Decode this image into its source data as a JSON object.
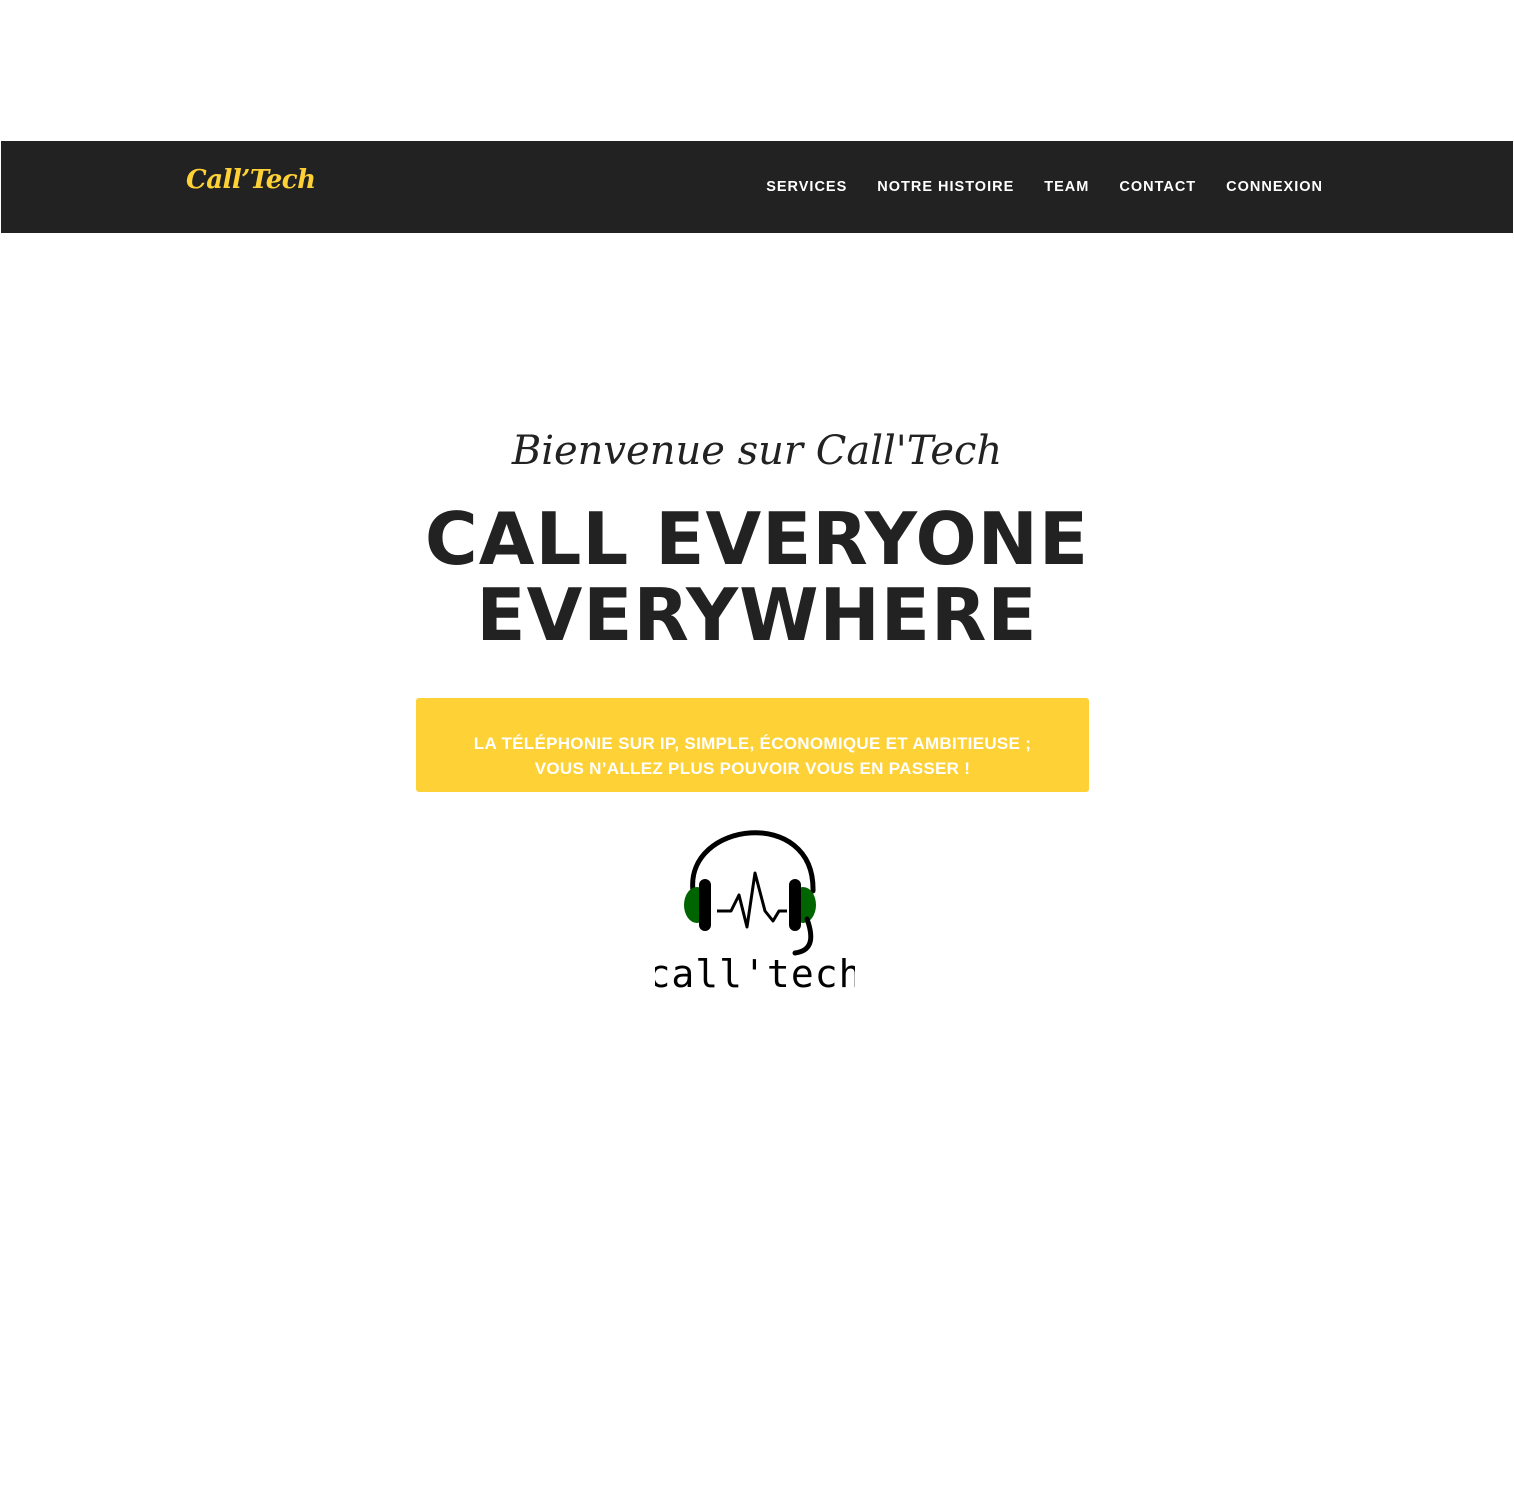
{
  "navbar": {
    "brand": "Call’Tech",
    "links": [
      {
        "label": "SERVICES"
      },
      {
        "label": "NOTRE HISTOIRE"
      },
      {
        "label": "TEAM"
      },
      {
        "label": "CONTACT"
      },
      {
        "label": "CONNEXION"
      }
    ]
  },
  "hero": {
    "subtitle": "Bienvenue sur Call'Tech",
    "headline_line1": "CALL EVERYONE",
    "headline_line2": "EVERYWHERE",
    "cta_line1": "LA TÉLÉPHONIE SUR IP, SIMPLE, ÉCONOMIQUE ET AMBITIEUSE ;",
    "cta_line2": "VOUS N’ALLEZ PLUS POUVOIR VOUS EN PASSER !"
  },
  "logo": {
    "text": "call'tech",
    "icon": "headset-icon",
    "colors": {
      "ear": "#006400",
      "line": "#000000"
    }
  },
  "theme": {
    "navbar_bg": "#222222",
    "accent": "#fed136",
    "text": "#222222"
  }
}
